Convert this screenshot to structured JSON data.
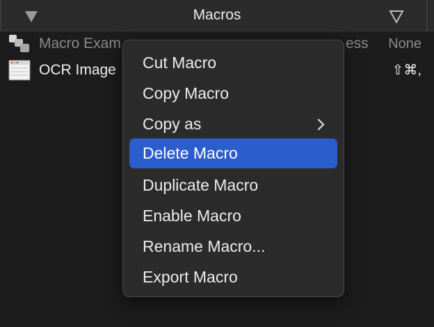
{
  "header": {
    "title": "Macros",
    "left_icon": "triangle-down-filled-icon",
    "right_icon": "triangle-down-outline-icon"
  },
  "list": {
    "rows": [
      {
        "label": "Macro Exam",
        "hidden_fragment": "ess",
        "trailing": "None",
        "icon": "macro-group-icon",
        "state": "dim"
      },
      {
        "label": "OCR Image",
        "trailing": "⇧⌘,",
        "icon": "window-icon",
        "state": "normal"
      }
    ]
  },
  "context_menu": {
    "items": [
      {
        "label": "Cut Macro"
      },
      {
        "label": "Copy Macro"
      },
      {
        "label": "Copy as",
        "submenu": true
      },
      {
        "label": "Delete Macro",
        "selected": true
      },
      {
        "label": "Duplicate Macro"
      },
      {
        "label": "Enable Macro"
      },
      {
        "label": "Rename Macro..."
      },
      {
        "label": "Export Macro"
      }
    ]
  },
  "colors": {
    "background": "#1e1e1e",
    "header": "#2b2b2b",
    "menu": "#2b2b2b",
    "selection": "#2c5dcc"
  }
}
